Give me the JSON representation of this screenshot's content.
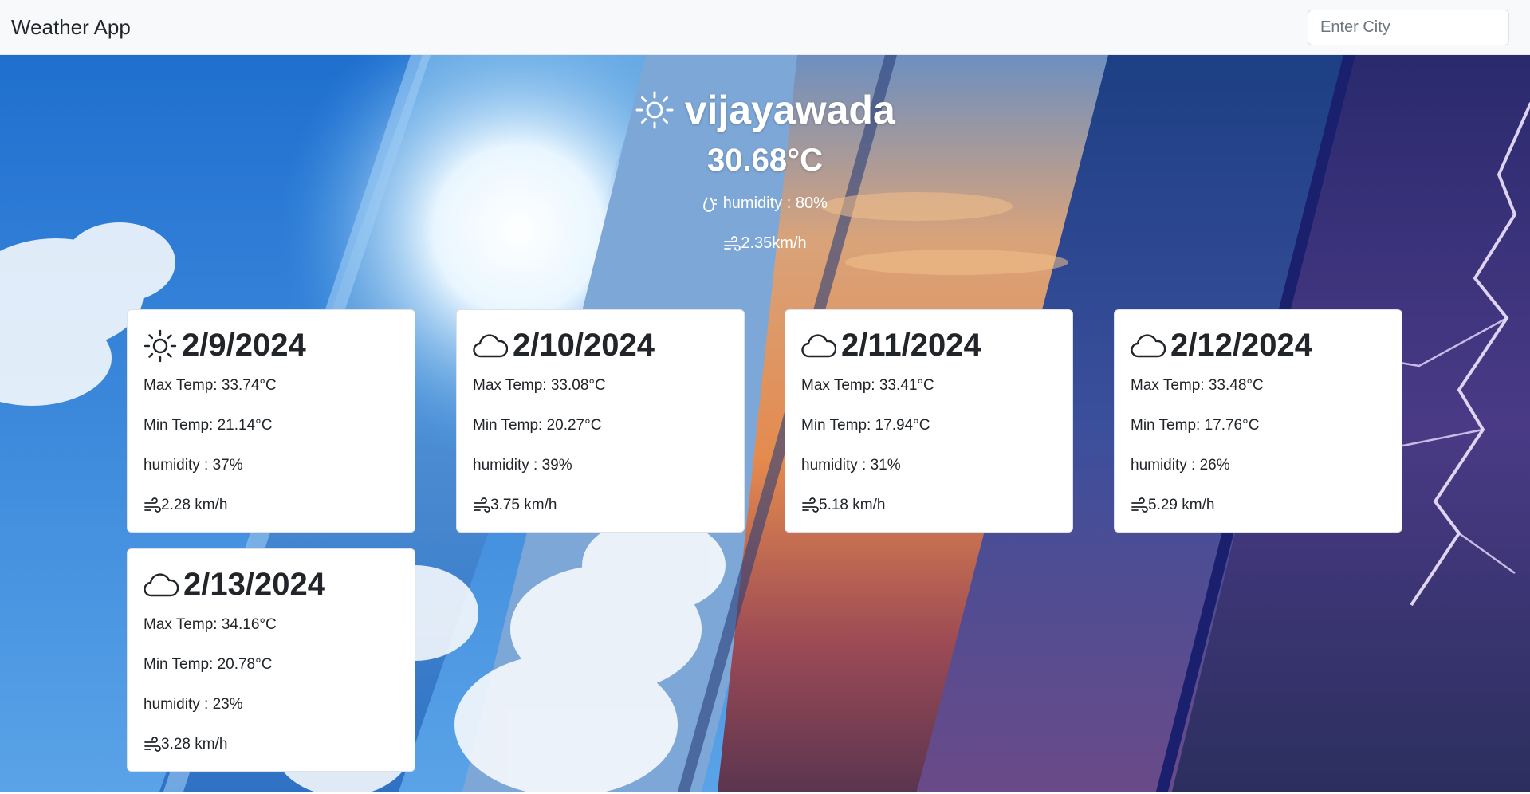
{
  "app": {
    "title": "Weather App"
  },
  "search": {
    "placeholder": "Enter City",
    "value": ""
  },
  "current": {
    "city": "vijayawada",
    "icon": "sun-icon",
    "temperature": "30.68°C",
    "humidity": "humidity : 80%",
    "wind": "2.35km/h"
  },
  "forecast": [
    {
      "icon": "sun-icon",
      "date": "2/9/2024",
      "max": "Max Temp: 33.74°C",
      "min": "Min Temp: 21.14°C",
      "humidity": "humidity : 37%",
      "wind": "2.28 km/h"
    },
    {
      "icon": "cloud-icon",
      "date": "2/10/2024",
      "max": "Max Temp: 33.08°C",
      "min": "Min Temp: 20.27°C",
      "humidity": "humidity : 39%",
      "wind": "3.75 km/h"
    },
    {
      "icon": "cloud-icon",
      "date": "2/11/2024",
      "max": "Max Temp: 33.41°C",
      "min": "Min Temp: 17.94°C",
      "humidity": "humidity : 31%",
      "wind": "5.18 km/h"
    },
    {
      "icon": "cloud-icon",
      "date": "2/12/2024",
      "max": "Max Temp: 33.48°C",
      "min": "Min Temp: 17.76°C",
      "humidity": "humidity : 26%",
      "wind": "5.29 km/h"
    },
    {
      "icon": "cloud-icon",
      "date": "2/13/2024",
      "max": "Max Temp: 34.16°C",
      "min": "Min Temp: 20.78°C",
      "humidity": "humidity : 23%",
      "wind": "3.28 km/h"
    }
  ]
}
